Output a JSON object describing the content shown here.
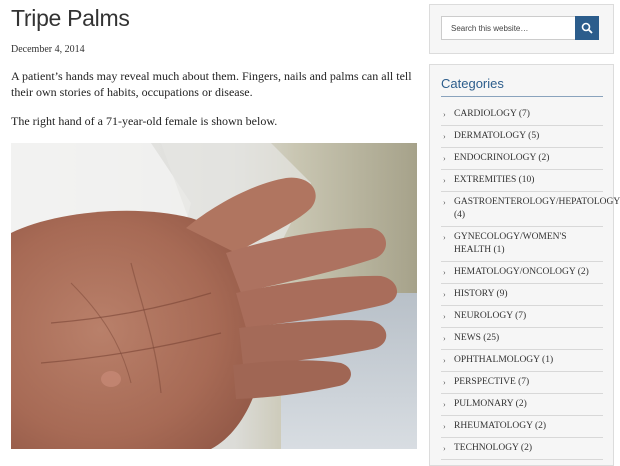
{
  "post": {
    "title": "Tripe Palms",
    "date": "December 4, 2014",
    "paragraph_1": "A patient’s hands may reveal much about them. Fingers, nails and palms can all tell their own stories of habits, occupations or disease.",
    "paragraph_2": "The right hand of a 71-year-old female is shown below."
  },
  "search": {
    "placeholder": "Search this website…",
    "button_icon": "search-icon"
  },
  "categories": {
    "title": "Categories",
    "items": [
      {
        "label": "CARDIOLOGY (7)"
      },
      {
        "label": "DERMATOLOGY (5)"
      },
      {
        "label": "ENDOCRINOLOGY (2)"
      },
      {
        "label": "EXTREMITIES (10)"
      },
      {
        "label": "GASTROENTEROLOGY/HEPATOLOGY (4)"
      },
      {
        "label": "GYNECOLOGY/WOMEN'S HEALTH (1)"
      },
      {
        "label": "HEMATOLOGY/ONCOLOGY (2)"
      },
      {
        "label": "HISTORY (9)"
      },
      {
        "label": "NEUROLOGY (7)"
      },
      {
        "label": "NEWS (25)"
      },
      {
        "label": "OPHTHALMOLOGY (1)"
      },
      {
        "label": "PERSPECTIVE (7)"
      },
      {
        "label": "PULMONARY (2)"
      },
      {
        "label": "RHEUMATOLOGY (2)"
      },
      {
        "label": "TECHNOLOGY (2)"
      }
    ]
  },
  "colors": {
    "accent": "#2c5d8c",
    "text": "#333333",
    "sidebar_bg": "#f6f6f6"
  }
}
